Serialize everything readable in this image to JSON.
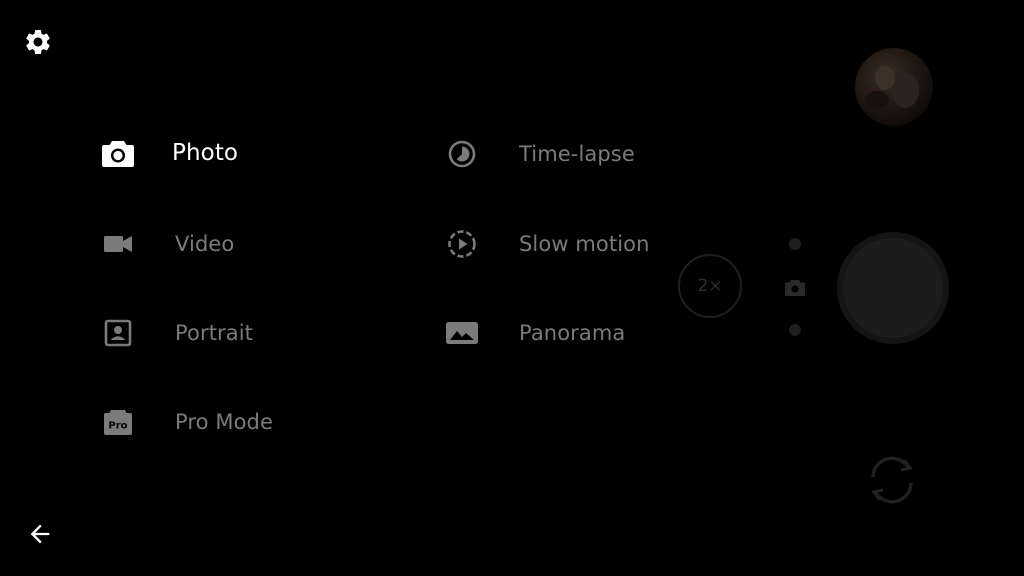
{
  "top_bar": {
    "settings_icon": "gear-icon"
  },
  "modes": {
    "photo": {
      "label": "Photo",
      "icon": "camera-icon",
      "active": true
    },
    "video": {
      "label": "Video",
      "icon": "video-camera-icon",
      "active": false
    },
    "portrait": {
      "label": "Portrait",
      "icon": "portrait-icon",
      "active": false
    },
    "pro_mode": {
      "label": "Pro Mode",
      "icon": "pro-icon",
      "icon_text": "Pro",
      "active": false
    },
    "time_lapse": {
      "label": "Time-lapse",
      "icon": "time-lapse-icon",
      "active": false
    },
    "slow_motion": {
      "label": "Slow motion",
      "icon": "slow-motion-icon",
      "active": false
    },
    "panorama": {
      "label": "Panorama",
      "icon": "panorama-icon",
      "active": false
    }
  },
  "camera_controls": {
    "zoom_label": "2×",
    "shutter_icon": "shutter-button",
    "switch_camera_icon": "switch-camera-icon",
    "thumbnail": "gallery-thumbnail"
  },
  "navigation": {
    "back_icon": "back-arrow-icon"
  },
  "colors": {
    "background": "#000000",
    "active_text": "#ffffff",
    "inactive_text": "#7b7b7b",
    "dimmed_control": "#1c1c1c"
  }
}
